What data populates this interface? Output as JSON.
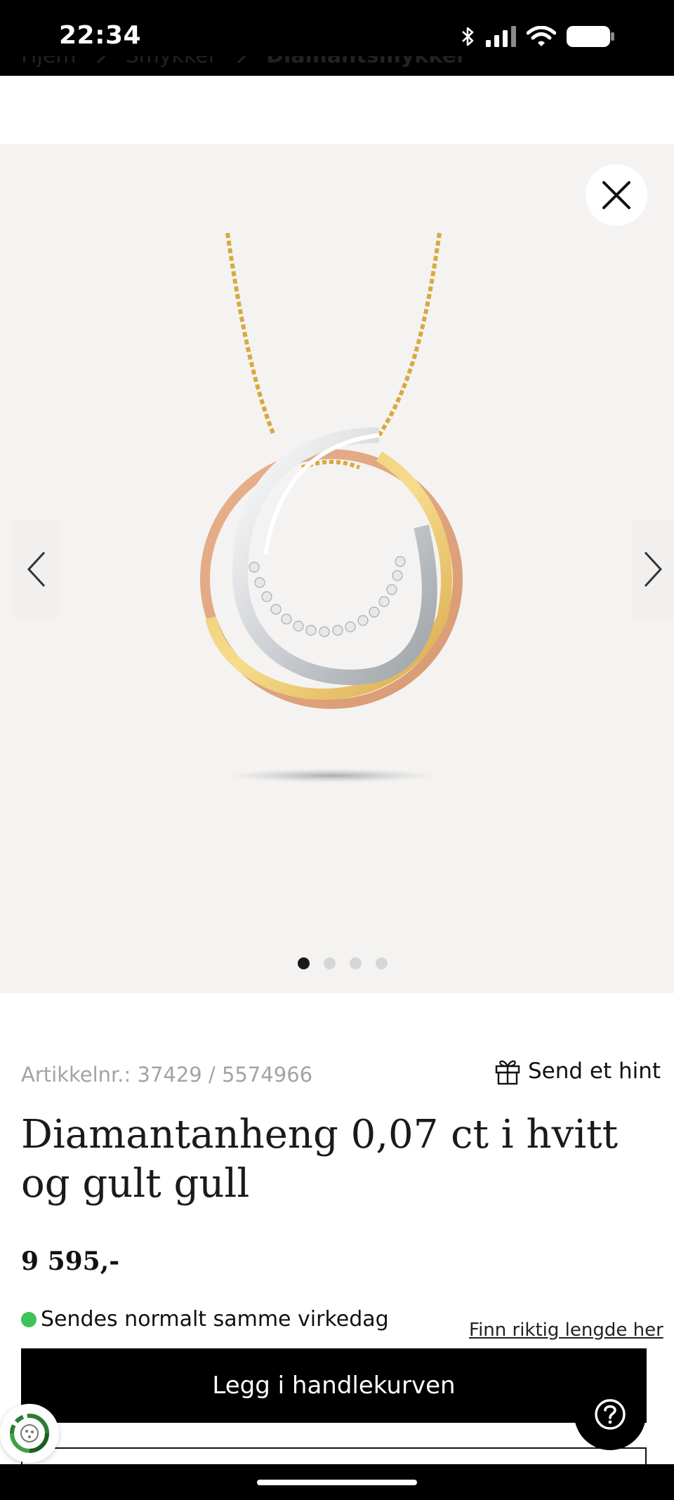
{
  "status_bar": {
    "time": "22:34",
    "icons": [
      "bluetooth-icon",
      "cellular-signal-icon",
      "wifi-icon",
      "battery-icon"
    ]
  },
  "breadcrumb": {
    "items": [
      "Hjem",
      "Smykker",
      "Diamantsmykker"
    ]
  },
  "gallery": {
    "image_alt": "Diamantanheng med hvitt, gult og rosé gull",
    "dots_count": 4,
    "active_dot": 1
  },
  "product": {
    "article_number": "Artikkelnr.: 37429 / 5574966",
    "hint_label": "Send et hint",
    "title": "Diamantanheng 0,07 ct i hvitt og gult gull",
    "price": "9 595,-",
    "stock_status": "Sendes normalt samme virkedag",
    "size_link": "Finn riktig lengde her",
    "add_to_cart": "Legg i handlekurven"
  },
  "colors": {
    "stock_dot": "#3ec35a",
    "gallery_bg": "#f4f3f2",
    "button_bg": "#000000"
  }
}
